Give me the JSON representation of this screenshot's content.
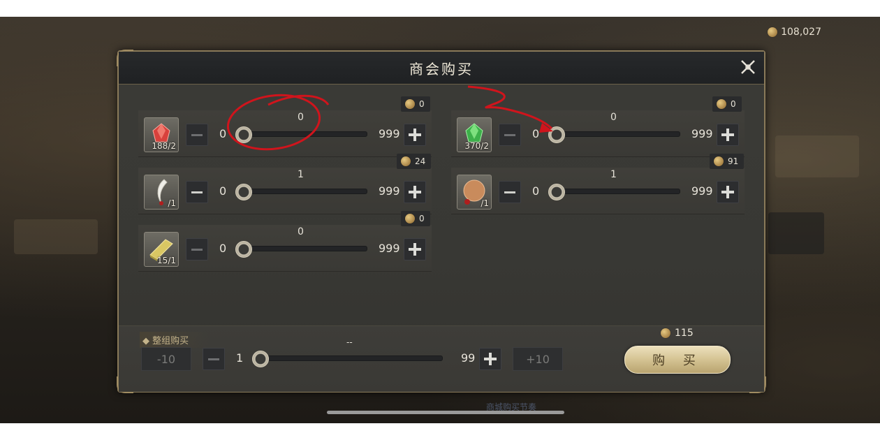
{
  "currency": {
    "amount": "108,027",
    "icon": "coin-icon"
  },
  "dialog": {
    "title": "商会购买",
    "items": [
      {
        "name": "red-gem",
        "qty": "188/2",
        "price": "0",
        "current": "0",
        "min": "0",
        "max": "999",
        "icon": "red-gem-icon"
      },
      {
        "name": "green-gem",
        "qty": "370/2",
        "price": "0",
        "current": "0",
        "min": "0",
        "max": "999",
        "icon": "green-gem-icon"
      },
      {
        "name": "fang",
        "qty": "/1",
        "price": "24",
        "current": "1",
        "min": "0",
        "max": "999",
        "icon": "fang-icon"
      },
      {
        "name": "orb",
        "qty": "/1",
        "price": "91",
        "current": "1",
        "min": "0",
        "max": "999",
        "icon": "orb-icon"
      },
      {
        "name": "gold-bar",
        "qty": "15/1",
        "price": "0",
        "current": "0",
        "min": "0",
        "max": "999",
        "icon": "gold-bar-icon"
      }
    ],
    "group": {
      "label": "整组购买",
      "minus10": "-10",
      "plus10": "+10",
      "min": "1",
      "max": "99",
      "current": "--"
    },
    "total_cost": "115",
    "buy_label": "购 买"
  },
  "footer_hint": "商城购买节奏",
  "colors": {
    "accent": "#d7c697",
    "annotation": "#d0141c"
  }
}
